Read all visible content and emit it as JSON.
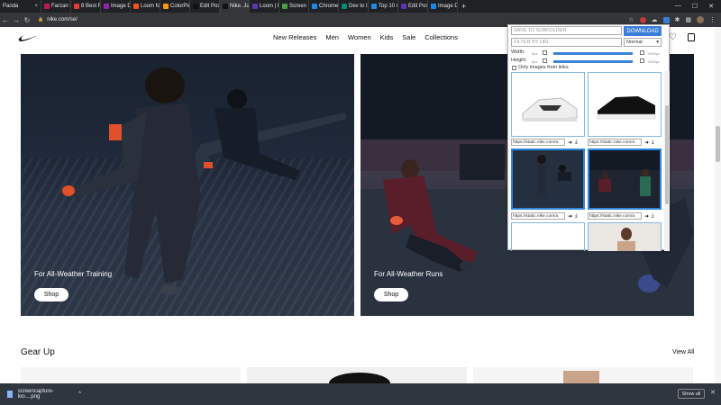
{
  "browser": {
    "tabs": [
      {
        "label": "Panda",
        "color": "#ffffff"
      },
      {
        "label": "Farzan F",
        "color": "#c2185b"
      },
      {
        "label": "8 Best F",
        "color": "#e53935"
      },
      {
        "label": "Image D",
        "color": "#8e24aa"
      },
      {
        "label": "Loom fo",
        "color": "#f4511e"
      },
      {
        "label": "ColorPic",
        "color": "#ff9800"
      },
      {
        "label": "Edit Pos",
        "color": "#111111"
      },
      {
        "label": "Nike. Ju",
        "color": "#111111"
      },
      {
        "label": "Loom | F",
        "color": "#5e35b1"
      },
      {
        "label": "Screen C",
        "color": "#43a047"
      },
      {
        "label": "Chrome",
        "color": "#1e88e5"
      },
      {
        "label": "Dev to In",
        "color": "#00897b"
      },
      {
        "label": "Top 10 c",
        "color": "#1e88e5"
      },
      {
        "label": "Edit Pos",
        "color": "#5e35b1"
      },
      {
        "label": "Image D",
        "color": "#1e88e5"
      }
    ],
    "active_tab_index": 7,
    "url": "nike.com/se/"
  },
  "nike": {
    "nav": [
      "New Releases",
      "Men",
      "Women",
      "Kids",
      "Sale",
      "Collections"
    ],
    "panels": [
      {
        "caption": "For All-Weather Training",
        "button": "Shop"
      },
      {
        "caption": "For All-Weather Runs",
        "button": "Shop"
      }
    ],
    "section_title": "Gear Up",
    "view_all": "View All"
  },
  "popup": {
    "subfolder_placeholder": "SAVE TO SUBFOLDER",
    "download_label": "DOWNLOAD",
    "filter_placeholder": "FILTER BY URL",
    "mode": "Normal",
    "width_label": "Width:",
    "height_label": "Height:",
    "min_value": "0px",
    "max_value": "3000px",
    "only_links_label": "Only images from links",
    "thumb_urls": [
      "https://static.nike.com/a",
      "https://static.nike.com/a",
      "https://static.nike.com/a",
      "https://static.nike.com/a"
    ]
  },
  "downloads": {
    "filename": "screencapture-loo....png",
    "show_all": "Show all"
  },
  "colors": {
    "accent": "#3b7dd8",
    "selected": "#2e86de"
  }
}
